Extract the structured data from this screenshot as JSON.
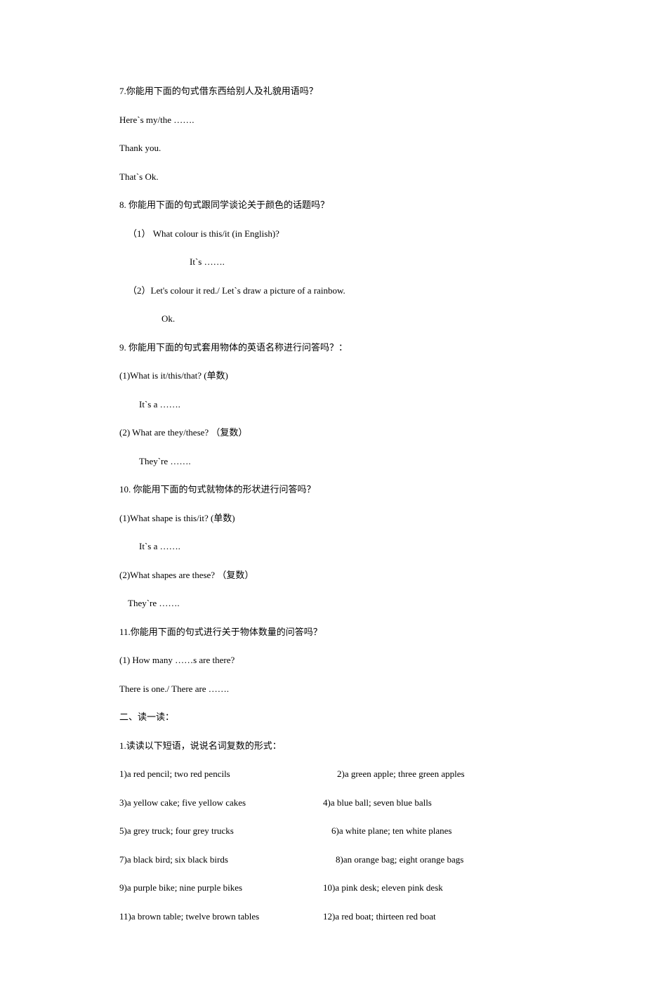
{
  "q7": {
    "title": "7.你能用下面的句式借东西给别人及礼貌用语吗？",
    "l1": "Here`s my/the …….",
    "l2": "Thank you.",
    "l3": "That`s Ok."
  },
  "q8": {
    "title": "8.  你能用下面的句式跟同学谈论关于颜色的话题吗？",
    "l1": "（1） What colour is this/it (in English)?",
    "l2": "It`s …….",
    "l3": "（2）Let's colour it red./ Let`s draw a picture of a rainbow.",
    "l4": "Ok."
  },
  "q9": {
    "title": "9.  你能用下面的句式套用物体的英语名称进行问答吗？：",
    "l1": "(1)What is it/this/that? (单数)",
    "l2": "It`s a …….",
    "l3": "(2)  What are they/these? （复数）",
    "l4": "They`re …….  "
  },
  "q10": {
    "title": "10.  你能用下面的句式就物体的形状进行问答吗？",
    "l1": "(1)What shape is this/it? (单数)",
    "l2": "It`s a …….",
    "l3": "(2)What shapes are these? （复数）",
    "l4": "They`re …….  "
  },
  "q11": {
    "title": "11.你能用下面的句式进行关于物体数量的问答吗？",
    "l1": "(1) How many ……s are there?",
    "l2": "There is one./ There are ……."
  },
  "section2": {
    "title": "二、读一读：",
    "sub": "1.读读以下短语，说说名词复数的形式："
  },
  "pairs": [
    {
      "left": "1)a red pencil; two red pencils",
      "right": "2)a green apple; three green apples"
    },
    {
      "left": "3)a yellow cake; five yellow cakes",
      "right": "4)a blue ball; seven blue balls"
    },
    {
      "left": "5)a grey truck; four grey trucks",
      "right": "6)a white plane; ten white planes"
    },
    {
      "left": "7)a black bird; six black birds",
      "right": "8)an orange bag; eight orange bags"
    },
    {
      "left": "9)a purple bike; nine purple bikes",
      "right": "10)a pink desk; eleven pink desk"
    },
    {
      "left": "11)a brown table; twelve brown tables",
      "right": "12)a red boat; thirteen red boat"
    }
  ]
}
